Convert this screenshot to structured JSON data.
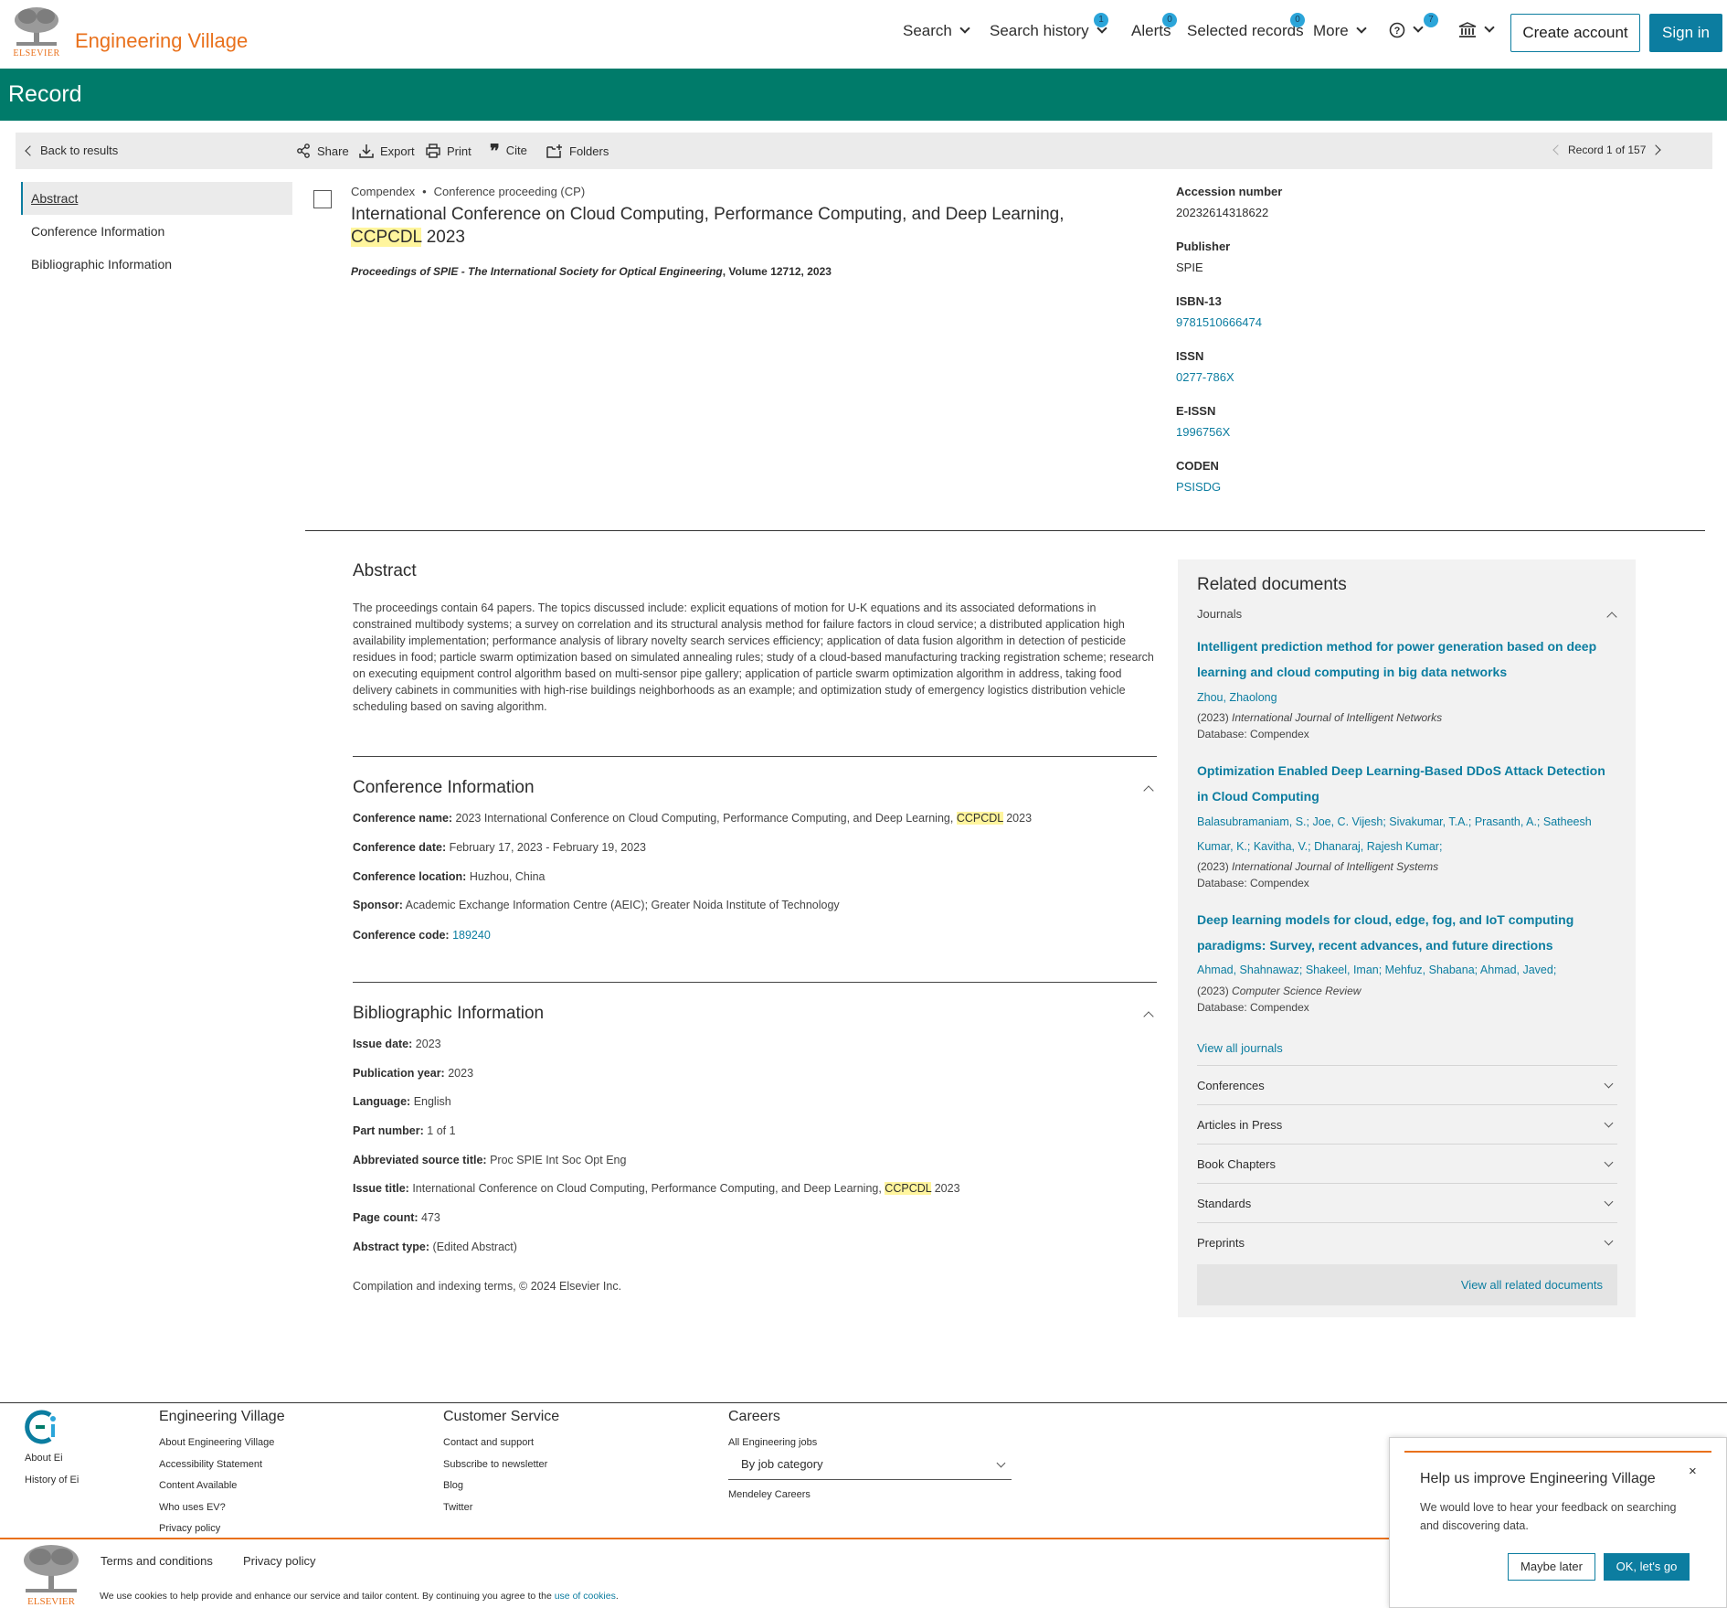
{
  "header": {
    "logo_word": "ELSEVIER",
    "brand": "Engineering Village",
    "nav": {
      "search": "Search",
      "search_history": "Search history",
      "search_history_count": "1",
      "alerts": "Alerts",
      "alerts_count": "0",
      "selected_records": "Selected records",
      "selected_records_count": "0",
      "more": "More",
      "help_count": "7"
    },
    "create_account": "Create account",
    "sign_in": "Sign in"
  },
  "banner": {
    "title": "Record"
  },
  "toolbar": {
    "back": "Back to results",
    "share": "Share",
    "export": "Export",
    "print": "Print",
    "cite": "Cite",
    "folders": "Folders",
    "record_position": "Record 1 of 157"
  },
  "sidenav": {
    "items": [
      "Abstract",
      "Conference Information",
      "Bibliographic Information"
    ]
  },
  "record": {
    "database": "Compendex",
    "doc_type": "Conference proceeding (CP)",
    "title_part1": "International Conference on Cloud Computing, Performance Computing, and Deep Learning, ",
    "title_highlight": "CCPCDL",
    "title_part2": " 2023",
    "source_italic": "Proceedings of SPIE - The International Society for Optical Engineering",
    "source_rest": ", Volume 12712, 2023"
  },
  "details": {
    "accession_label": "Accession number",
    "accession_value": "20232614318622",
    "publisher_label": "Publisher",
    "publisher_value": "SPIE",
    "isbn_label": "ISBN-13",
    "isbn_value": "9781510666474",
    "issn_label": "ISSN",
    "issn_value": "0277-786X",
    "eissn_label": "E-ISSN",
    "eissn_value": "1996756X",
    "coden_label": "CODEN",
    "coden_value": "PSISDG"
  },
  "abstract": {
    "heading": "Abstract",
    "text": "The proceedings contain 64 papers. The topics discussed include: explicit equations of motion for U-K equations and its associated deformations in constrained multibody systems; a survey on correlation and its structural analysis method for failure factors in cloud service; a distributed application high availability implementation; performance analysis of library novelty search services efficiency; application of data fusion algorithm in detection of pesticide residues in food; particle swarm optimization based on simulated annealing rules; study of a cloud-based manufacturing tracking registration scheme; research on executing equipment control algorithm based on multi-sensor pipe gallery; application of particle swarm optimization algorithm in address, taking food delivery cabinets in communities with high-rise buildings neighborhoods as an example; and optimization study of emergency logistics distribution vehicle scheduling based on saving algorithm."
  },
  "conference": {
    "heading": "Conference Information",
    "name_label": "Conference name:",
    "name_part1": "2023 International Conference on Cloud Computing, Performance Computing, and Deep Learning, ",
    "name_highlight": "CCPCDL",
    "name_part2": " 2023",
    "date_label": "Conference date:",
    "date_value": "February 17, 2023 - February 19, 2023",
    "location_label": "Conference location:",
    "location_value": "Huzhou, China",
    "sponsor_label": "Sponsor:",
    "sponsor_value": "Academic Exchange Information Centre (AEIC); Greater Noida Institute of Technology",
    "code_label": "Conference code:",
    "code_value": "189240"
  },
  "bibliographic": {
    "heading": "Bibliographic Information",
    "issue_date_label": "Issue date:",
    "issue_date_value": "2023",
    "pub_year_label": "Publication year:",
    "pub_year_value": "2023",
    "language_label": "Language:",
    "language_value": "English",
    "part_label": "Part number:",
    "part_value": "1 of 1",
    "abbrev_label": "Abbreviated source title:",
    "abbrev_value": "Proc SPIE Int Soc Opt Eng",
    "issue_title_label": "Issue title:",
    "issue_title_part1": "International Conference on Cloud Computing, Performance Computing, and Deep Learning, ",
    "issue_title_highlight": "CCPCDL",
    "issue_title_part2": " 2023",
    "page_count_label": "Page count:",
    "page_count_value": "473",
    "abstract_type_label": "Abstract type:",
    "abstract_type_value": "(Edited Abstract)",
    "compilation": "Compilation and indexing terms, © 2024 Elsevier Inc."
  },
  "related": {
    "heading": "Related documents",
    "journals_label": "Journals",
    "docs": [
      {
        "title": "Intelligent prediction method for power generation based on deep learning and cloud computing in big data networks",
        "authors": "Zhou, Zhaolong",
        "year": "(2023) ",
        "journal": "International Journal of Intelligent Networks",
        "database": "Database: Compendex"
      },
      {
        "title": "Optimization Enabled Deep Learning-Based DDoS Attack Detection in Cloud Computing",
        "authors": "Balasubramaniam, S.; Joe, C. Vijesh; Sivakumar, T.A.; Prasanth, A.; Satheesh Kumar, K.; Kavitha, V.; Dhanaraj, Rajesh Kumar;",
        "year": "(2023) ",
        "journal": "International Journal of Intelligent Systems",
        "database": "Database: Compendex"
      },
      {
        "title": "Deep learning models for cloud, edge, fog, and IoT computing paradigms: Survey, recent advances, and future directions",
        "authors": "Ahmad, Shahnawaz; Shakeel, Iman; Mehfuz, Shabana; Ahmad, Javed;",
        "year": "(2023) ",
        "journal": "Computer Science Review",
        "database": "Database: Compendex"
      }
    ],
    "view_all_journals": "View all journals",
    "sections": [
      "Conferences",
      "Articles in Press",
      "Book Chapters",
      "Standards",
      "Preprints"
    ],
    "view_all_related": "View all related documents"
  },
  "footer": {
    "ei_links": [
      "About Ei",
      "History of Ei"
    ],
    "ev_heading": "Engineering Village",
    "ev_links": [
      "About Engineering Village",
      "Accessibility Statement",
      "Content Available",
      "Who uses EV?",
      "Privacy policy"
    ],
    "cs_heading": "Customer Service",
    "cs_links": [
      "Contact and support",
      "Subscribe to newsletter",
      "Blog",
      "Twitter"
    ],
    "careers_heading": "Careers",
    "careers_all": "All Engineering jobs",
    "job_select": "By job category",
    "mendeley": "Mendeley Careers",
    "terms": "Terms and conditions",
    "privacy": "Privacy policy",
    "cookie_text": "We use cookies to help provide and enhance our service and tailor content. By continuing you agree to the ",
    "cookie_link": "use of cookies",
    "cookie_end": ".",
    "logo_word": "ELSEVIER"
  },
  "popup": {
    "close": "×",
    "title": "Help us improve Engineering Village",
    "text": "We would love to hear your feedback on searching and discovering data.",
    "maybe": "Maybe later",
    "ok": "OK, let's go"
  },
  "colors": {
    "brand_orange": "#e9711c",
    "banner_teal": "#007b6a",
    "link_blue": "#0c7da0",
    "badge_blue": "#2ba5d9",
    "highlight_yellow": "#fff59d"
  }
}
